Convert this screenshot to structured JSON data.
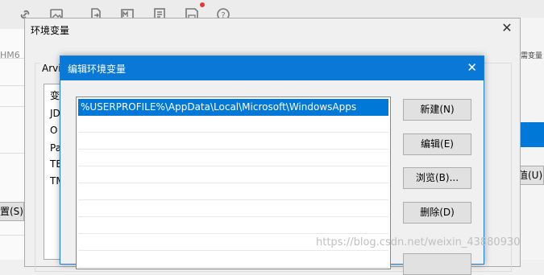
{
  "toolbar": {
    "icons": [
      "link-icon",
      "image-icon",
      "export-icon",
      "markdown-icon",
      "document-icon",
      "save-icon",
      "help-icon"
    ]
  },
  "background_app": {
    "left_text": "HM6",
    "left_button_label": "置(S)..",
    "right_button_label": "值(U)",
    "right_small_text": "需变量"
  },
  "env_window": {
    "title": "环境变量",
    "group_label": "Arvi",
    "list_items": [
      "变",
      "JD",
      "O",
      "Pa",
      "TE",
      "TM"
    ]
  },
  "edit_dialog": {
    "title": "编辑环境变量",
    "entries": [
      "%USERPROFILE%\\AppData\\Local\\Microsoft\\WindowsApps"
    ],
    "buttons": {
      "new": "新建(N)",
      "edit": "编辑(E)",
      "browse": "浏览(B)...",
      "delete": "删除(D)"
    }
  },
  "watermark": "https://blog.csdn.net/weixin_43880930",
  "colors": {
    "title_bar": "#0a78d6",
    "selection": "#0078d7"
  }
}
